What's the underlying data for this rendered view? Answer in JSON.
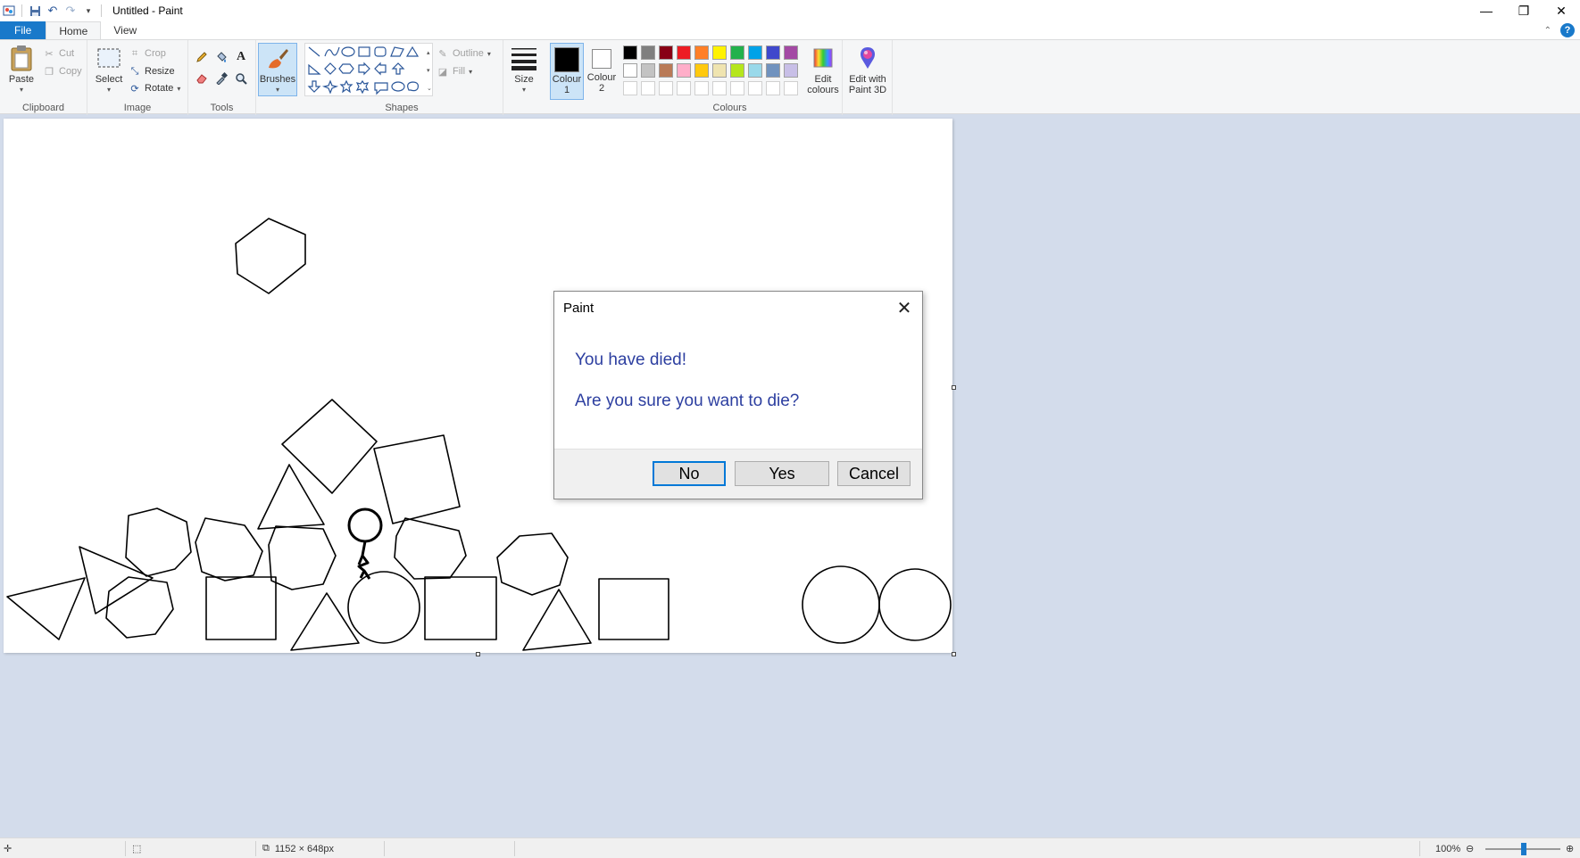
{
  "window": {
    "title": "Untitled - Paint",
    "controls": {
      "minimize": "—",
      "restore": "❐",
      "close": "✕"
    }
  },
  "tabs": [
    {
      "label": "File"
    },
    {
      "label": "Home"
    },
    {
      "label": "View"
    }
  ],
  "ribbon": {
    "clipboard": {
      "group_label": "Clipboard",
      "paste": "Paste",
      "cut": "Cut",
      "copy": "Copy"
    },
    "image": {
      "group_label": "Image",
      "select": "Select",
      "crop": "Crop",
      "resize": "Resize",
      "rotate": "Rotate"
    },
    "tools": {
      "group_label": "Tools"
    },
    "brushes": {
      "label": "Brushes"
    },
    "shapes": {
      "group_label": "Shapes",
      "outline": "Outline",
      "fill": "Fill"
    },
    "size": {
      "label": "Size"
    },
    "colour1": {
      "label_line1": "Colour",
      "label_line2": "1",
      "color": "#000000"
    },
    "colour2": {
      "label_line1": "Colour",
      "label_line2": "2",
      "color": "#ffffff"
    },
    "colours": {
      "group_label": "Colours",
      "row1": [
        "#000000",
        "#7f7f7f",
        "#880015",
        "#ed1c24",
        "#ff7f27",
        "#fff200",
        "#22b14c",
        "#00a2e8",
        "#3f48cc",
        "#a349a4"
      ],
      "row2": [
        "#ffffff",
        "#c3c3c3",
        "#b97a57",
        "#ffaec9",
        "#ffc90e",
        "#efe4b0",
        "#b5e61d",
        "#99d9ea",
        "#7092be",
        "#c8bfe7"
      ]
    },
    "edit_colours": {
      "label_line1": "Edit",
      "label_line2": "colours"
    },
    "paint3d": {
      "label_line1": "Edit with",
      "label_line2": "Paint 3D"
    }
  },
  "dialog": {
    "title": "Paint",
    "message1": "You have died!",
    "message2": "Are you sure you want to die?",
    "buttons": {
      "no": "No",
      "yes": "Yes",
      "cancel": "Cancel"
    }
  },
  "statusbar": {
    "canvas_size": "1152 × 648px",
    "zoom": "100%"
  }
}
